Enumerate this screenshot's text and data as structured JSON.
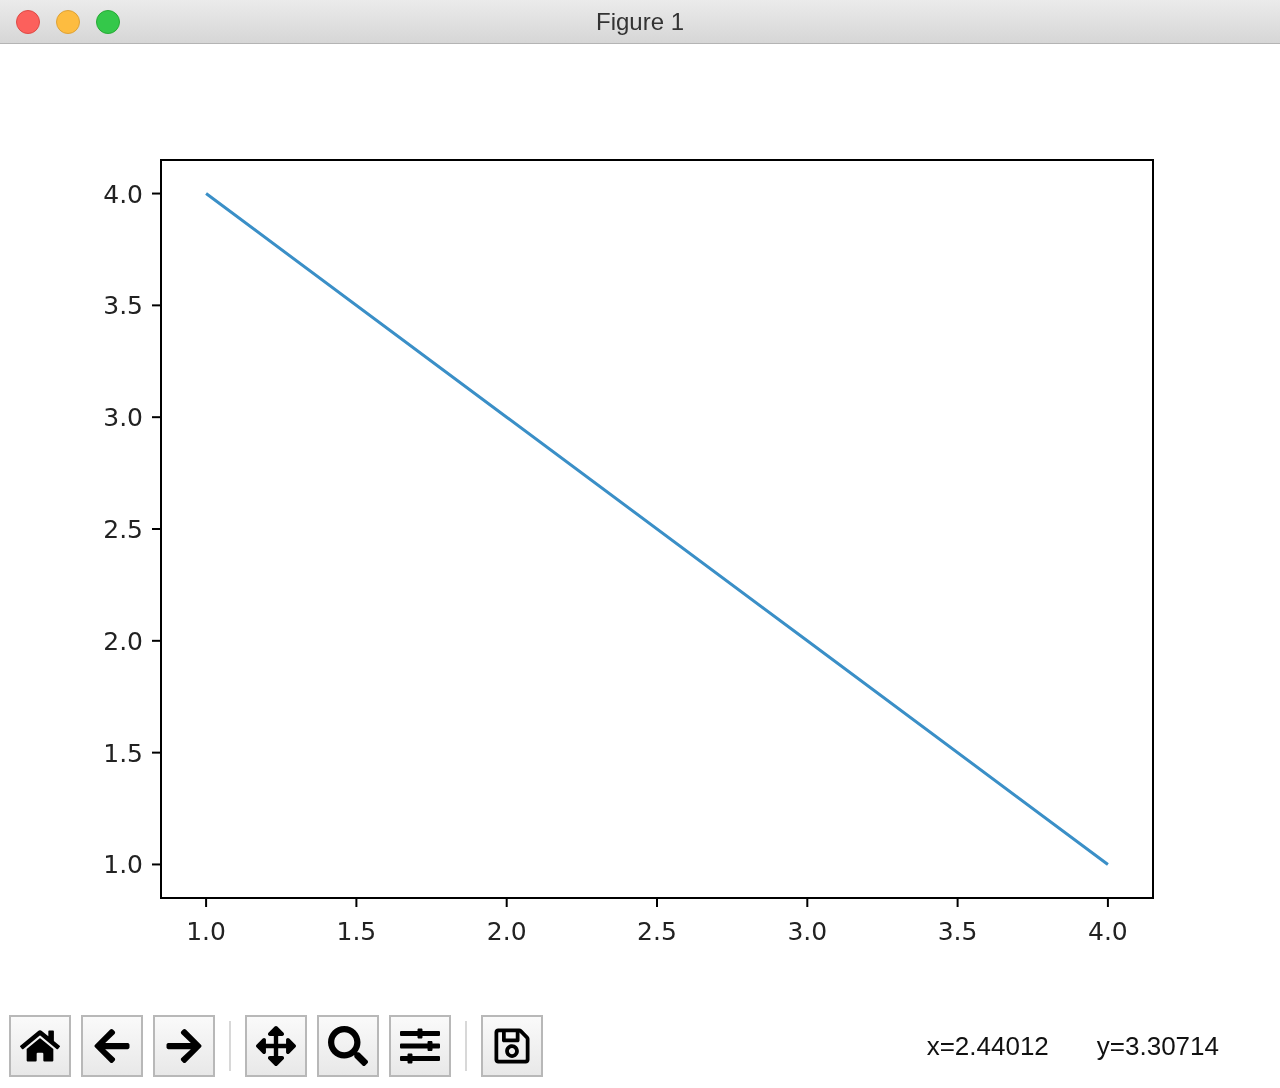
{
  "window": {
    "title": "Figure 1"
  },
  "figure": {
    "chart_data": {
      "type": "line",
      "x": [
        1,
        2,
        3,
        4
      ],
      "series": [
        {
          "color": "#3a8fc7",
          "values": [
            4,
            3,
            2,
            1
          ]
        }
      ],
      "xlim": [
        0.85,
        4.15
      ],
      "ylim": [
        0.85,
        4.15
      ],
      "xticks": [
        {
          "value": 1,
          "label": "1.0"
        },
        {
          "value": 1.5,
          "label": "1.5"
        },
        {
          "value": 2,
          "label": "2.0"
        },
        {
          "value": 2.5,
          "label": "2.5"
        },
        {
          "value": 3,
          "label": "3.0"
        },
        {
          "value": 3.5,
          "label": "3.5"
        },
        {
          "value": 4,
          "label": "4.0"
        }
      ],
      "yticks": [
        {
          "value": 1,
          "label": "1.0"
        },
        {
          "value": 1.5,
          "label": "1.5"
        },
        {
          "value": 2,
          "label": "2.0"
        },
        {
          "value": 2.5,
          "label": "2.5"
        },
        {
          "value": 3,
          "label": "3.0"
        },
        {
          "value": 3.5,
          "label": "3.5"
        },
        {
          "value": 4,
          "label": "4.0"
        }
      ]
    }
  },
  "toolbar": {
    "groups": [
      [
        {
          "kind": "home"
        },
        {
          "kind": "back"
        },
        {
          "kind": "forward"
        }
      ],
      [
        {
          "kind": "pan"
        },
        {
          "kind": "zoom"
        },
        {
          "kind": "configure"
        }
      ],
      [
        {
          "kind": "save"
        }
      ]
    ]
  },
  "status": {
    "x": "x=2.44012",
    "y": "y=3.30714"
  }
}
